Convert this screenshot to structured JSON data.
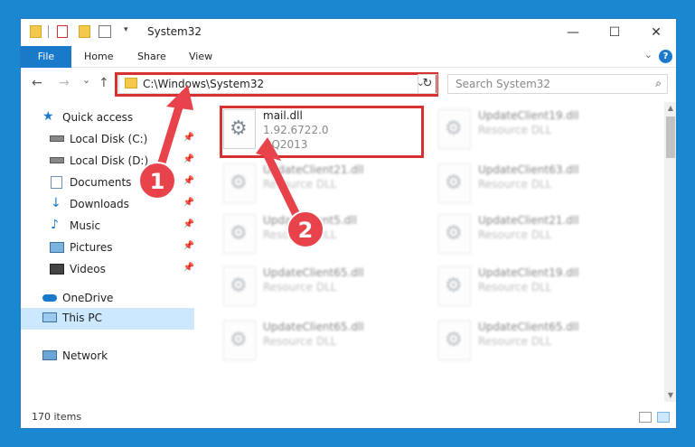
{
  "window": {
    "title": "System32",
    "controls": {
      "minimize": "—",
      "maximize": "☐",
      "close": "✕"
    }
  },
  "ribbon": {
    "tabs": [
      "File",
      "Home",
      "Share",
      "View"
    ],
    "help": "?",
    "expand": "⌄"
  },
  "nav": {
    "back": "←",
    "forward": "→",
    "recent": "⌄",
    "up": "↑",
    "address": "C:\\Windows\\System32",
    "address_dropdown": "⌄",
    "refresh": "↻",
    "search_placeholder": "Search System32"
  },
  "sidebar": {
    "items": [
      {
        "label": "Quick access",
        "icon": "star-icon",
        "pinned": false
      },
      {
        "label": "Local Disk (C:)",
        "icon": "drive-icon",
        "pinned": true
      },
      {
        "label": "Local Disk (D:)",
        "icon": "drive-icon",
        "pinned": true
      },
      {
        "label": "Documents",
        "icon": "documents-icon",
        "pinned": true
      },
      {
        "label": "Downloads",
        "icon": "downloads-icon",
        "pinned": true
      },
      {
        "label": "Music",
        "icon": "music-icon",
        "pinned": true
      },
      {
        "label": "Pictures",
        "icon": "pictures-icon",
        "pinned": true
      },
      {
        "label": "Videos",
        "icon": "videos-icon",
        "pinned": true
      },
      {
        "label": "OneDrive",
        "icon": "cloud-icon",
        "pinned": false
      },
      {
        "label": "This PC",
        "icon": "computer-icon",
        "pinned": false,
        "selected": true
      },
      {
        "label": "Network",
        "icon": "network-icon",
        "pinned": false
      }
    ],
    "pin_glyph": "📌"
  },
  "files": {
    "left": [
      {
        "name": "mail.dll",
        "line2": "1.92.6722.0",
        "line3": "QQ2013"
      },
      {
        "name": "UpdateClient21.dll",
        "line2": "Resource DLL",
        "line3": ""
      },
      {
        "name": "UpdateClient5.dll",
        "line2": "Resource DLL",
        "line3": ""
      },
      {
        "name": "UpdateClient65.dll",
        "line2": "Resource DLL",
        "line3": ""
      },
      {
        "name": "UpdateClient65.dll",
        "line2": "Resource DLL",
        "line3": ""
      }
    ],
    "right": [
      {
        "name": "UpdateClient19.dll",
        "line2": "Resource DLL"
      },
      {
        "name": "UpdateClient63.dll",
        "line2": "Resource DLL"
      },
      {
        "name": "UpdateClient21.dll",
        "line2": "Resource DLL"
      },
      {
        "name": "UpdateClient19.dll",
        "line2": "Resource DLL"
      },
      {
        "name": "UpdateClient65.dll",
        "line2": "Resource DLL"
      }
    ]
  },
  "status": {
    "count": "170 items"
  },
  "annotations": {
    "marker1": "1",
    "marker2": "2",
    "arrow_color": "#e8434a"
  }
}
